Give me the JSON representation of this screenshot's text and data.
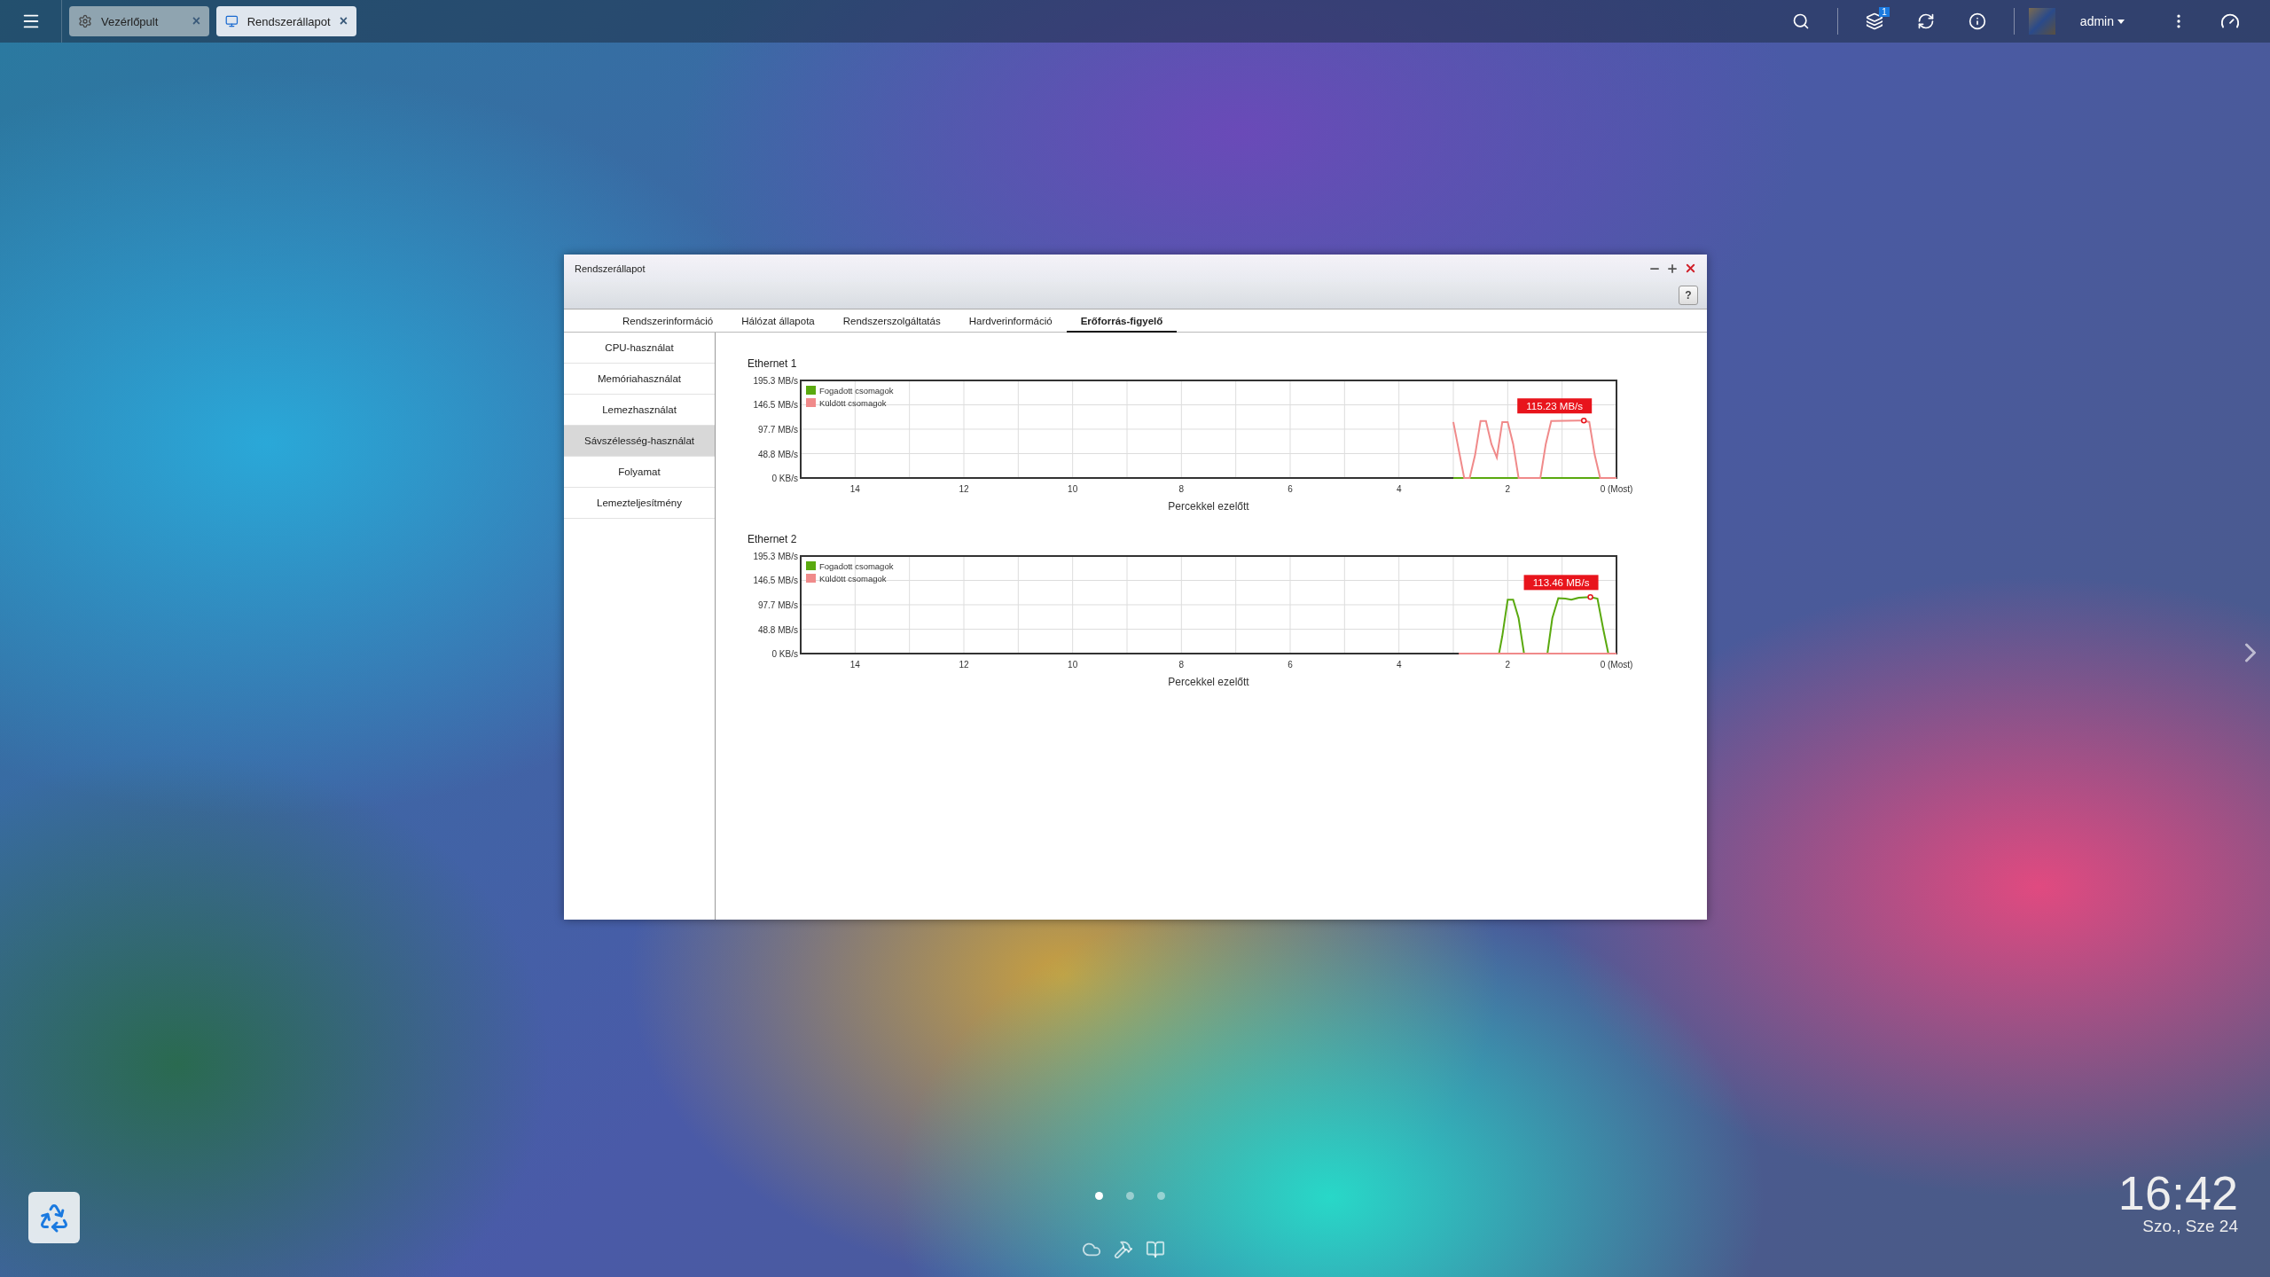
{
  "taskbar": {
    "tabs": [
      {
        "label": "Vezérlőpult",
        "kind": "settings",
        "selected": false,
        "close": "×"
      },
      {
        "label": "Rendszerállapot",
        "kind": "monitor",
        "selected": true,
        "close": "×"
      }
    ],
    "notification_count": "1",
    "user": "admin"
  },
  "window": {
    "title": "Rendszerállapot",
    "help": "?",
    "tabs": [
      {
        "label": "Rendszerinformáció",
        "selected": false
      },
      {
        "label": "Hálózat állapota",
        "selected": false
      },
      {
        "label": "Rendszerszolgáltatás",
        "selected": false
      },
      {
        "label": "Hardverinformáció",
        "selected": false
      },
      {
        "label": "Erőforrás-figyelő",
        "selected": true
      }
    ],
    "sidebar": {
      "items": [
        {
          "label": "CPU-használat",
          "selected": false
        },
        {
          "label": "Memóriahasználat",
          "selected": false
        },
        {
          "label": "Lemezhasználat",
          "selected": false
        },
        {
          "label": "Sávszélesség-használat",
          "selected": true
        },
        {
          "label": "Folyamat",
          "selected": false
        },
        {
          "label": "Lemezteljesítmény",
          "selected": false
        }
      ]
    },
    "charts": [
      {
        "title": "Ethernet 1",
        "chart_data": {
          "type": "line",
          "xlabel": "Percekkel ezelőtt",
          "x": [
            3.0,
            2.8,
            2.7,
            2.6,
            2.5,
            2.4,
            2.3,
            2.2,
            2.1,
            2.0,
            1.9,
            1.8,
            1.4,
            1.3,
            1.2,
            0.6,
            0.5,
            0.4,
            0.3,
            0
          ],
          "series": [
            {
              "name": "Fogadott csomagok",
              "color": "#5aa90f",
              "values": [
                0,
                0,
                0,
                0,
                0,
                0,
                0,
                0,
                0,
                0,
                0,
                0,
                0,
                0,
                0,
                0,
                0,
                0,
                0,
                0
              ]
            },
            {
              "name": "Küldött csomagok",
              "color": "#f08a8a",
              "values": [
                112,
                0,
                0,
                46,
                114,
                114,
                68,
                41,
                112,
                112,
                68,
                0,
                0,
                68,
                114,
                115,
                112,
                46,
                0,
                0
              ]
            }
          ],
          "xlim": [
            15,
            0
          ],
          "ylim": [
            0,
            195.3
          ],
          "xticks": [
            14,
            12,
            10,
            8,
            6,
            4,
            2,
            {
              "value": 0,
              "label": "0 (Most)"
            }
          ],
          "yticks": [
            {
              "value": 0,
              "label": "0 KB/s"
            },
            {
              "value": 48.8,
              "label": "48.8 MB/s"
            },
            {
              "value": 97.7,
              "label": "97.7 MB/s"
            },
            {
              "value": 146.5,
              "label": "146.5 MB/s"
            },
            {
              "value": 195.3,
              "label": "195.3 MB/s"
            }
          ],
          "annotations": [
            {
              "x": 0.6,
              "y": 115,
              "text": "115.23 MB/s"
            }
          ],
          "grid": true,
          "legend": true
        }
      },
      {
        "title": "Ethernet 2",
        "chart_data": {
          "type": "line",
          "xlabel": "Percekkel ezelőtt",
          "x": [
            2.9,
            2.16,
            2.1,
            2.0,
            1.9,
            1.8,
            1.7,
            1.27,
            1.18,
            1.07,
            0.94,
            0.83,
            0.69,
            0.48,
            0.35,
            0.24,
            0.15,
            0
          ],
          "series": [
            {
              "name": "Fogadott csomagok",
              "color": "#5aa90f",
              "values": [
                null,
                0,
                35,
                108,
                108,
                71,
                0,
                0,
                71,
                111,
                110,
                108,
                112,
                113,
                110,
                47,
                0,
                null
              ]
            },
            {
              "name": "Küldött csomagok",
              "color": "#f08a8a",
              "values": [
                0,
                0,
                0,
                0,
                0,
                0,
                0,
                0,
                0,
                0,
                0,
                0,
                0,
                0,
                0,
                0,
                0,
                0
              ]
            }
          ],
          "xlim": [
            15,
            0
          ],
          "ylim": [
            0,
            195.3
          ],
          "xticks": [
            14,
            12,
            10,
            8,
            6,
            4,
            2,
            {
              "value": 0,
              "label": "0 (Most)"
            }
          ],
          "yticks": [
            {
              "value": 0,
              "label": "0 KB/s"
            },
            {
              "value": 48.8,
              "label": "48.8 MB/s"
            },
            {
              "value": 97.7,
              "label": "97.7 MB/s"
            },
            {
              "value": 146.5,
              "label": "146.5 MB/s"
            },
            {
              "value": 195.3,
              "label": "195.3 MB/s"
            }
          ],
          "annotations": [
            {
              "x": 0.48,
              "y": 113,
              "text": "113.46 MB/s"
            }
          ],
          "grid": true,
          "legend": true
        }
      }
    ]
  },
  "desktop": {
    "pages": [
      {
        "selected": true
      },
      {
        "selected": false
      },
      {
        "selected": false
      }
    ],
    "clock": {
      "time": "16:42",
      "date": "Szo., Sze 24"
    }
  }
}
